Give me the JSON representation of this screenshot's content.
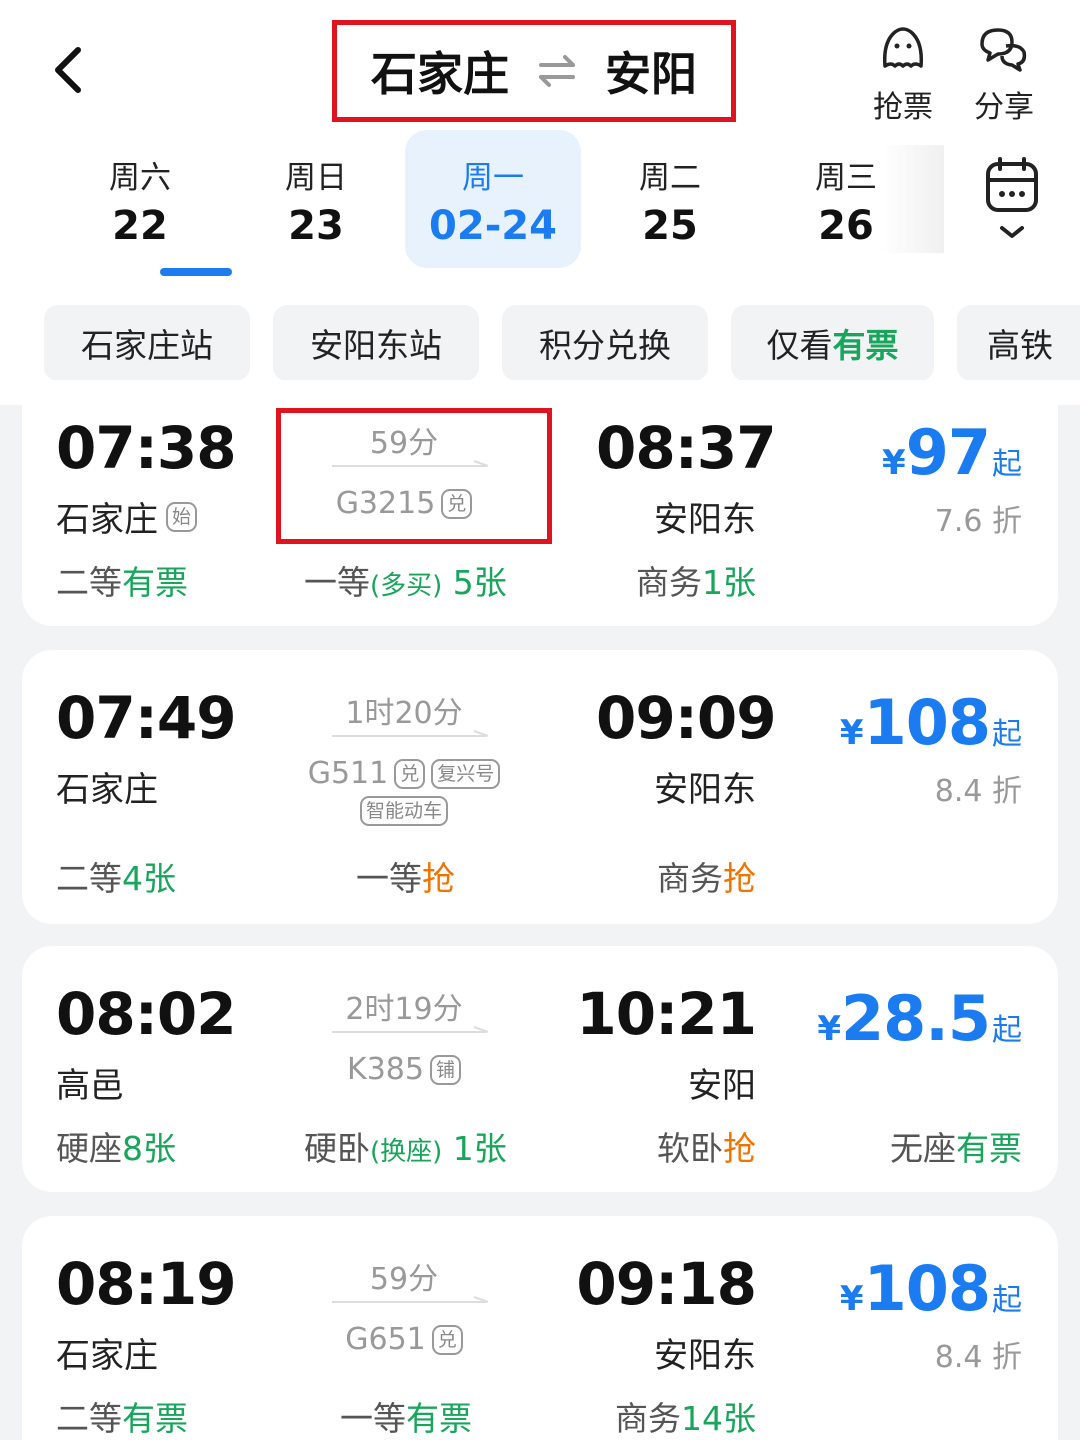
{
  "route": {
    "from": "石家庄",
    "to": "安阳"
  },
  "header_actions": [
    {
      "label": "抢票",
      "icon": "ghost-icon"
    },
    {
      "label": "分享",
      "icon": "chat-icon"
    }
  ],
  "dates": [
    {
      "weekday": "周六",
      "day": "22"
    },
    {
      "weekday": "周日",
      "day": "23"
    },
    {
      "weekday": "周一",
      "day": "02-24",
      "selected": true
    },
    {
      "weekday": "周二",
      "day": "25"
    },
    {
      "weekday": "周三",
      "day": "26"
    }
  ],
  "filters": [
    {
      "label": "石家庄站"
    },
    {
      "label": "安阳东站"
    },
    {
      "label": "积分兑换"
    },
    {
      "label_prefix": "仅看",
      "label_highlight": "有票"
    },
    {
      "label": "高铁"
    }
  ],
  "colors": {
    "accent": "#1a7cf0",
    "available": "#19a55b",
    "grab": "#f27300",
    "highlight_box": "#e0141e"
  },
  "trains": [
    {
      "depart_time": "07:38",
      "depart_station": "石家庄",
      "depart_badge": "始",
      "duration": "59分",
      "train_no": "G3215",
      "train_badges": [
        "兑"
      ],
      "arrive_time": "08:37",
      "arrive_station": "安阳东",
      "price_currency": "¥",
      "price": "97",
      "price_suffix": "起",
      "discount": "7.6 折",
      "seats": [
        {
          "name": "二等",
          "status": "有票"
        },
        {
          "name": "一等",
          "note": "(多买)",
          "status": "5张"
        },
        {
          "name": "商务",
          "status": "1张"
        }
      ]
    },
    {
      "depart_time": "07:49",
      "depart_station": "石家庄",
      "duration": "1时20分",
      "train_no": "G511",
      "train_badges": [
        "兑",
        "复兴号",
        "智能动车"
      ],
      "arrive_time": "09:09",
      "arrive_station": "安阳东",
      "price_currency": "¥",
      "price": "108",
      "price_suffix": "起",
      "discount": "8.4 折",
      "seats": [
        {
          "name": "二等",
          "status": "4张"
        },
        {
          "name": "一等",
          "status": "抢"
        },
        {
          "name": "商务",
          "status": "抢"
        }
      ]
    },
    {
      "depart_time": "08:02",
      "depart_station": "高邑",
      "duration": "2时19分",
      "train_no": "K385",
      "train_badges": [
        "铺"
      ],
      "arrive_time": "10:21",
      "arrive_station": "安阳",
      "price_currency": "¥",
      "price": "28.5",
      "price_suffix": "起",
      "seats": [
        {
          "name": "硬座",
          "status": "8张"
        },
        {
          "name": "硬卧",
          "note": "(换座)",
          "status": "1张"
        },
        {
          "name": "软卧",
          "status": "抢"
        },
        {
          "name": "无座",
          "status": "有票"
        }
      ]
    },
    {
      "depart_time": "08:19",
      "depart_station": "石家庄",
      "duration": "59分",
      "train_no": "G651",
      "train_badges": [
        "兑"
      ],
      "arrive_time": "09:18",
      "arrive_station": "安阳东",
      "price_currency": "¥",
      "price": "108",
      "price_suffix": "起",
      "discount": "8.4 折",
      "seats": [
        {
          "name": "二等",
          "status": "有票"
        },
        {
          "name": "一等",
          "status": "有票"
        },
        {
          "name": "商务",
          "status": "14张"
        }
      ]
    }
  ]
}
